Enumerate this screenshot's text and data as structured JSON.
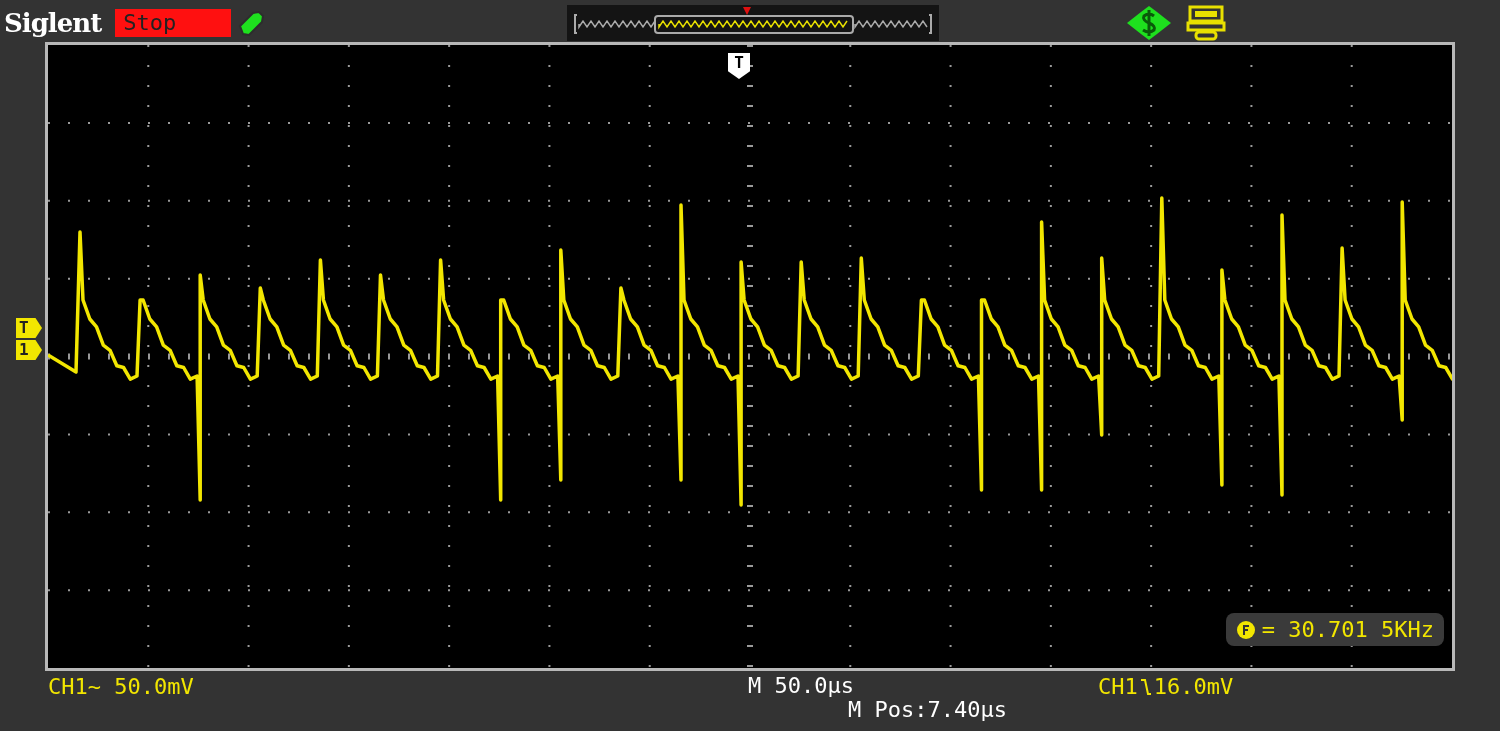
{
  "header": {
    "brand": "Siglent",
    "run_state": {
      "label": "Stop",
      "kind": "stopped"
    }
  },
  "trigger_marker": {
    "label": "T"
  },
  "channel_markers": [
    {
      "label": "T"
    },
    {
      "label": "1"
    }
  ],
  "frequency": {
    "value": "= 30.701 5KHz"
  },
  "status_bar": {
    "channel": {
      "name": "CH1",
      "coupling": "~",
      "scale": "50.0mV"
    },
    "timebase": "M 50.0µs",
    "position": "M Pos:7.40µs",
    "trigger": {
      "source": "CH1",
      "level": "16.0mV"
    }
  }
}
